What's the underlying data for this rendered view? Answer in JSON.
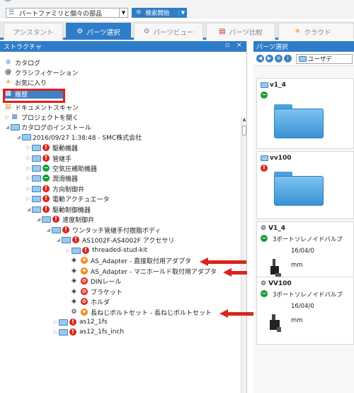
{
  "toolbar": {
    "collapse_icon": "double-chevron-icon",
    "combo_text": "パートファミリと個々の部品",
    "search_label": "検索開始"
  },
  "tabs": [
    {
      "label": "アシスタント",
      "icon": ""
    },
    {
      "label": "パーツ選択",
      "icon": "⚙"
    },
    {
      "label": "パーツビュー",
      "icon": "⚙"
    },
    {
      "label": "パーツ比較",
      "icon": "▤"
    },
    {
      "label": "クラウド",
      "icon": "✳"
    }
  ],
  "structure_panel": {
    "title": "ストラクチャ",
    "close": "×",
    "pin": "▫",
    "items": [
      {
        "label": "カタログ"
      },
      {
        "label": "クラシフィケーション"
      },
      {
        "label": "お気に入り"
      },
      {
        "label": "履歴"
      },
      {
        "label": "ドキュメントスキャン"
      },
      {
        "label": "プロジェクトを開く"
      },
      {
        "label": "カタログのインストール"
      },
      {
        "label": "2016/09/27 1:38:48 - SMC株式会社"
      },
      {
        "label": "駆動機器"
      },
      {
        "label": "管継手"
      },
      {
        "label": "空気圧補助機器"
      },
      {
        "label": "潤滑機器"
      },
      {
        "label": "方向制御弁"
      },
      {
        "label": "電動アクチュエータ"
      },
      {
        "label": "駆動制御機器"
      },
      {
        "label": "速度制御弁"
      },
      {
        "label": "ワンタッチ管継手付樹脂ボディ"
      },
      {
        "label": "AS1002F-AS4002F アクセサリ"
      },
      {
        "label": "threaded-stud-kit"
      },
      {
        "label": "AS_Adapter - 直接取付用アダプタ"
      },
      {
        "label": "AS_Adapter - マニホールド取付用アダプタ"
      },
      {
        "label": "DINレール"
      },
      {
        "label": "ブラケット"
      },
      {
        "label": "ホルダ"
      },
      {
        "label": "長ねじボルトセット - 長ねじボルトセット"
      },
      {
        "label": "as12_1fs"
      },
      {
        "label": "as12_1fs_inch"
      }
    ]
  },
  "parts_panel": {
    "title": "パーツ選択",
    "breadcrumb": "ユーザデ",
    "cards": [
      {
        "title": "v1_4"
      },
      {
        "title": "vv100"
      },
      {
        "title": "V1_4",
        "desc": "3ポートソレノイドバルブ",
        "date": "16/04/0",
        "unit": "mm"
      },
      {
        "title": "VV100",
        "desc": "3ポートソレノイドバルブ",
        "date": "16/04/0",
        "unit": "mm"
      }
    ]
  },
  "colors": {
    "accent": "#2f7dc9",
    "highlight": "#e31c1c",
    "status_red": "#d9261c",
    "status_green": "#1c9c3c"
  }
}
